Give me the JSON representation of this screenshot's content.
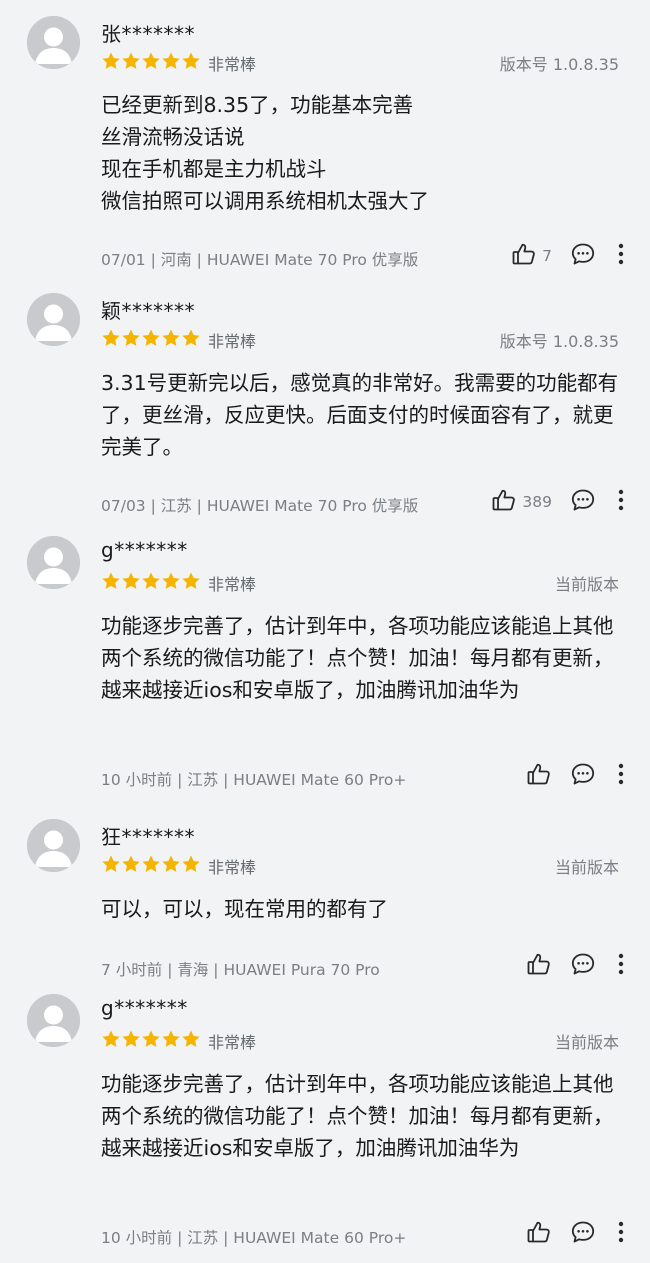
{
  "colors": {
    "background": "#f1f3f5",
    "star": "#f5b400",
    "avatar": "#c8cacd",
    "meta_text": "#7a7f84"
  },
  "icons": {
    "avatar": "default-user-avatar-icon",
    "star": "star-icon",
    "like": "thumbs-up-icon",
    "comment": "comment-bubble-icon",
    "more": "vertical-ellipsis-icon"
  },
  "reviews": [
    {
      "username": "张*******",
      "stars": 5,
      "rating_label": "非常棒",
      "version": "版本号 1.0.8.35",
      "text": "已经更新到8.35了，功能基本完善\n丝滑流畅没话说\n现在手机都是主力机战斗\n微信拍照可以调用系统相机太强大了",
      "meta": "07/01 | 河南 | HUAWEI Mate 70 Pro 优享版",
      "likes": "7"
    },
    {
      "username": "颖*******",
      "stars": 5,
      "rating_label": "非常棒",
      "version": "版本号 1.0.8.35",
      "text": "3.31号更新完以后，感觉真的非常好。我需要的功能都有了，更丝滑，反应更快。后面支付的时候面容有了，就更完美了。",
      "meta": "07/03 | 江苏 | HUAWEI Mate 70 Pro 优享版",
      "likes": "389"
    },
    {
      "username": "g*******",
      "stars": 5,
      "rating_label": "非常棒",
      "version": "当前版本",
      "text": "功能逐步完善了，估计到年中，各项功能应该能追上其他两个系统的微信功能了！点个赞！加油！每月都有更新，越来越接近ios和安卓版了，加油腾讯加油华为",
      "meta": "10 小时前 | 江苏 | HUAWEI Mate 60 Pro+",
      "likes": ""
    },
    {
      "username": "狂*******",
      "stars": 5,
      "rating_label": "非常棒",
      "version": "当前版本",
      "text": "可以，可以，现在常用的都有了",
      "meta": "7 小时前 | 青海 | HUAWEI Pura 70 Pro",
      "likes": ""
    },
    {
      "username": "g*******",
      "stars": 5,
      "rating_label": "非常棒",
      "version": "当前版本",
      "text": "功能逐步完善了，估计到年中，各项功能应该能追上其他两个系统的微信功能了！点个赞！加油！每月都有更新，越来越接近ios和安卓版了，加油腾讯加油华为",
      "meta": "10 小时前 | 江苏 | HUAWEI Mate 60 Pro+",
      "likes": ""
    }
  ]
}
